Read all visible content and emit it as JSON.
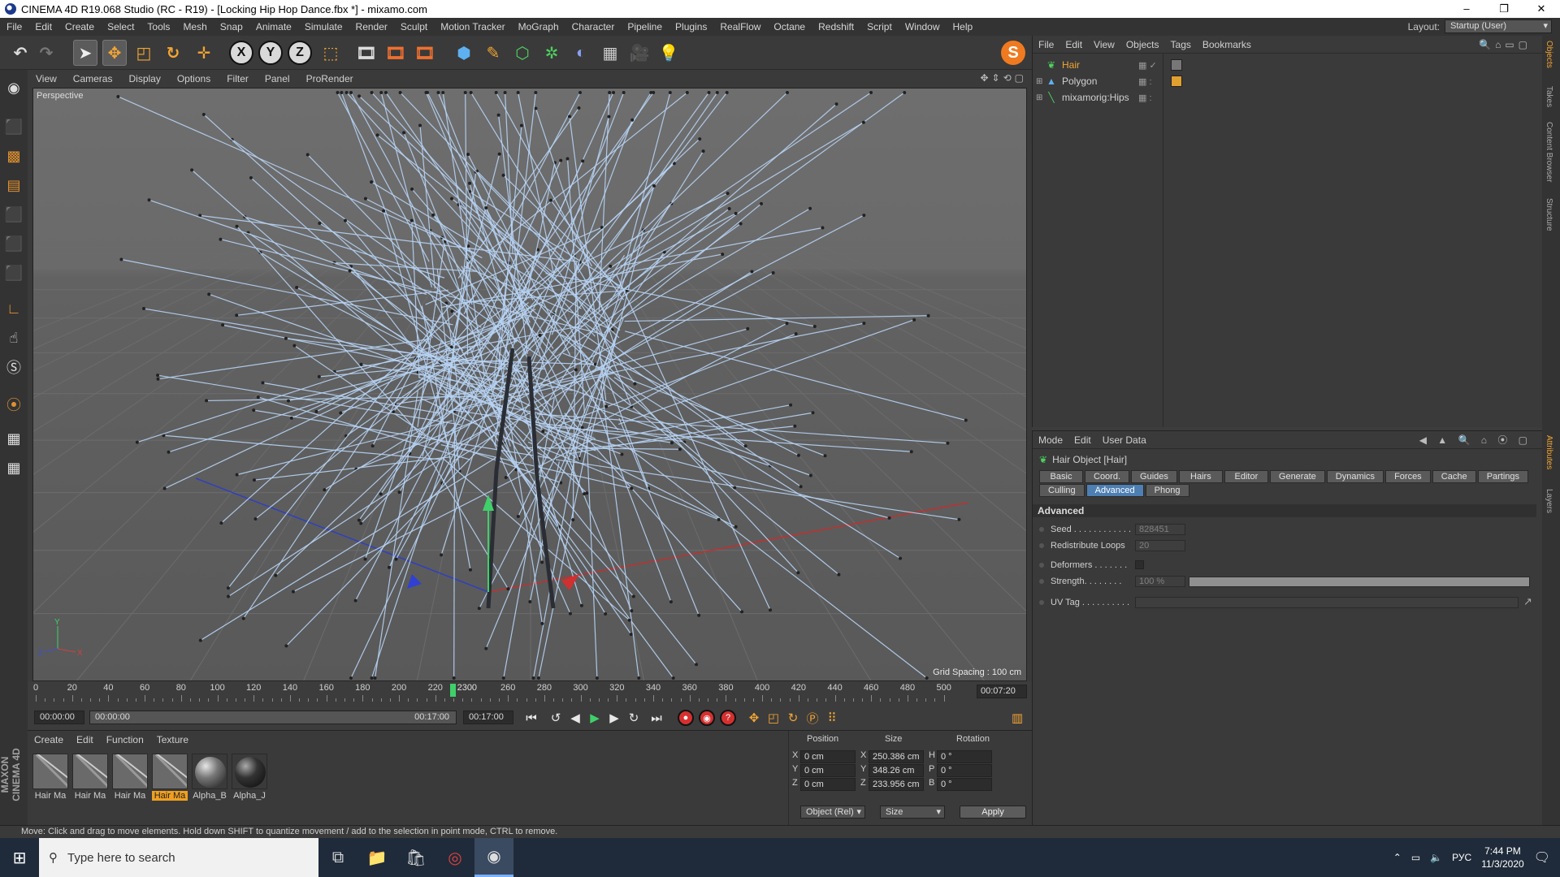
{
  "window": {
    "title": "CINEMA 4D R19.068 Studio (RC - R19) - [Locking Hip Hop Dance.fbx *] - mixamo.com",
    "controls": [
      "–",
      "❐",
      "✕"
    ]
  },
  "main_menu": {
    "items": [
      "File",
      "Edit",
      "Create",
      "Select",
      "Tools",
      "Mesh",
      "Snap",
      "Animate",
      "Simulate",
      "Render",
      "Sculpt",
      "Motion Tracker",
      "MoGraph",
      "Character",
      "Pipeline",
      "Plugins",
      "RealFlow",
      "Octane",
      "Redshift",
      "Script",
      "Window",
      "Help"
    ],
    "layout_label": "Layout:",
    "layout_value": "Startup (User)"
  },
  "toolbar": {
    "axis_x": "X",
    "axis_y": "Y",
    "axis_z": "Z"
  },
  "viewport": {
    "menu": [
      "View",
      "Cameras",
      "Display",
      "Options",
      "Filter",
      "Panel",
      "ProRender"
    ],
    "camera_label": "Perspective",
    "grid_spacing": "Grid Spacing : 100 cm",
    "axis_labels": {
      "y": "Y",
      "z": "Z",
      "x": "X"
    }
  },
  "timeline": {
    "ticks": [
      "0",
      "20",
      "40",
      "60",
      "80",
      "100",
      "120",
      "140",
      "160",
      "180",
      "200",
      "220",
      "260",
      "280",
      "300",
      "320",
      "340",
      "360",
      "380",
      "400",
      "420",
      "440",
      "460",
      "480",
      "500"
    ],
    "playhead_label": "2300",
    "end_time": "00:07:20"
  },
  "transport": {
    "current_time": "00:00:00",
    "range_start": "00:00:00",
    "range_end": "00:17:00",
    "max_time": "00:17:00"
  },
  "material_manager": {
    "menu": [
      "Create",
      "Edit",
      "Function",
      "Texture"
    ],
    "materials": [
      {
        "name": "Hair Ma",
        "kind": "hair",
        "selected": false
      },
      {
        "name": "Hair Ma",
        "kind": "hair",
        "selected": false
      },
      {
        "name": "Hair Ma",
        "kind": "hair",
        "selected": false
      },
      {
        "name": "Hair Ma",
        "kind": "hair",
        "selected": true
      },
      {
        "name": "Alpha_B",
        "kind": "sphere",
        "selected": false
      },
      {
        "name": "Alpha_J",
        "kind": "sphere-dark",
        "selected": false
      }
    ],
    "logo": "MAXON CINEMA 4D"
  },
  "coordinates": {
    "headers": {
      "position": "Position",
      "size": "Size",
      "rotation": "Rotation"
    },
    "rows": [
      {
        "axis": "X",
        "pos": "0 cm",
        "size_axis": "X",
        "size": "250.386 cm",
        "rot_axis": "H",
        "rot": "0 °"
      },
      {
        "axis": "Y",
        "pos": "0 cm",
        "size_axis": "Y",
        "size": "348.26 cm",
        "rot_axis": "P",
        "rot": "0 °"
      },
      {
        "axis": "Z",
        "pos": "0 cm",
        "size_axis": "Z",
        "size": "233.956 cm",
        "rot_axis": "B",
        "rot": "0 °"
      }
    ],
    "mode_select": "Object (Rel)",
    "size_select": "Size",
    "apply_label": "Apply"
  },
  "status": {
    "message": "Move: Click and drag to move elements. Hold down SHIFT to quantize movement / add to the selection in point mode, CTRL to remove."
  },
  "object_manager": {
    "menu": [
      "File",
      "Edit",
      "View",
      "Objects",
      "Tags",
      "Bookmarks"
    ],
    "objects": [
      {
        "name": "Hair",
        "icon": "hair-icon",
        "selected": true
      },
      {
        "name": "Polygon",
        "icon": "polygon-icon",
        "selected": false
      },
      {
        "name": "mixamorig:Hips",
        "icon": "joint-icon",
        "selected": false
      }
    ]
  },
  "attribute_manager": {
    "menu": [
      "Mode",
      "Edit",
      "User Data"
    ],
    "object_title": "Hair Object [Hair]",
    "tabs_row1": [
      "Basic",
      "Coord.",
      "Guides",
      "Hairs",
      "Editor",
      "Generate",
      "Dynamics",
      "Forces",
      "Cache",
      "Partings"
    ],
    "tabs_row2": [
      "Culling",
      "Advanced",
      "Phong"
    ],
    "active_tab": "Advanced",
    "section": "Advanced",
    "fields": {
      "seed_label": "Seed . . . . . . . . . . . .",
      "seed_value": "828451",
      "loops_label": "Redistribute Loops",
      "loops_value": "20",
      "deformers_label": "Deformers . . . . . . .",
      "strength_label": "Strength. . . . . . . .",
      "strength_value": "100 %",
      "uvtag_label": "UV Tag . . . . . . . . . ."
    }
  },
  "right_tabs": [
    "Objects",
    "Takes",
    "Content Browser",
    "Structure",
    "Attributes",
    "Layers"
  ],
  "taskbar": {
    "search_placeholder": "Type here to search",
    "language": "РУС",
    "time": "7:44 PM",
    "date": "11/3/2020"
  },
  "colors": {
    "accent_orange": "#f3a534",
    "active_tab": "#4d7fb3",
    "hair_guides": "#b8d4f5"
  }
}
